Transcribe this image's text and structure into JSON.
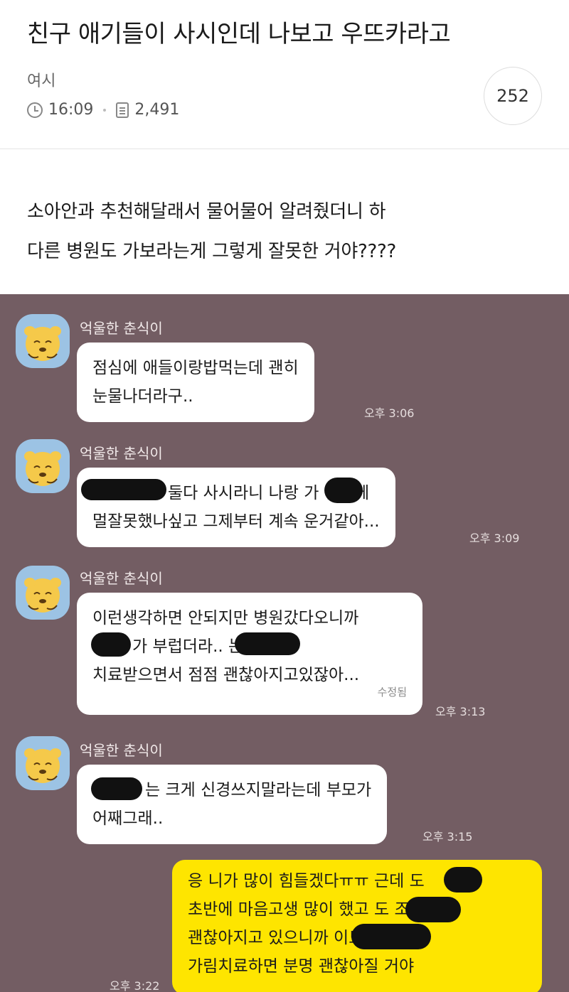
{
  "post": {
    "title": "친구 애기들이 사시인데 나보고 우뜨카라고",
    "author": "여시",
    "time": "16:09",
    "views": "2,491",
    "comment_count": "252"
  },
  "content": {
    "lines": [
      "소아안과 추천해달래서 물어물어 알려줬더니 하",
      "다른 병원도 가보라는게 그렇게 잘못한 거야????"
    ]
  },
  "chat": {
    "messages": [
      {
        "sender": "억울한 춘식이",
        "lines": [
          "점심에 애들이랑밥먹는데 괜히",
          "눈물나더라구.."
        ],
        "time": "오후 3:06"
      },
      {
        "sender": "억울한 춘식이",
        "lines": [
          "둘다 사시라니 나랑        가 전생에",
          "멀잘못했나싶고 그제부터 계속 운거같아..."
        ],
        "time": "오후 3:09"
      },
      {
        "sender": "억울한 춘식이",
        "lines": [
          "이런생각하면 안되지만 병원갔다오니까",
          "가 부럽더라..            는 너한테",
          "치료받으면서 점점 괜찮아지고있잖아..."
        ],
        "edited": "수정됨",
        "time": "오후 3:13"
      },
      {
        "sender": "억울한 춘식이",
        "lines": [
          "는 크게 신경쓰지말라는데 부모가",
          "어째그래.."
        ],
        "time": "오후 3:15"
      }
    ],
    "my_message": {
      "lines": [
        "응 니가 많이 힘들겠다ㅠㅠ 근데        도",
        "초반에 마음고생 많이 했고            도 조금씩",
        "괜찮아지고 있으니까               이도",
        "가림치료하면 분명 괜찮아질 거야"
      ],
      "time": "오후 3:22"
    }
  }
}
